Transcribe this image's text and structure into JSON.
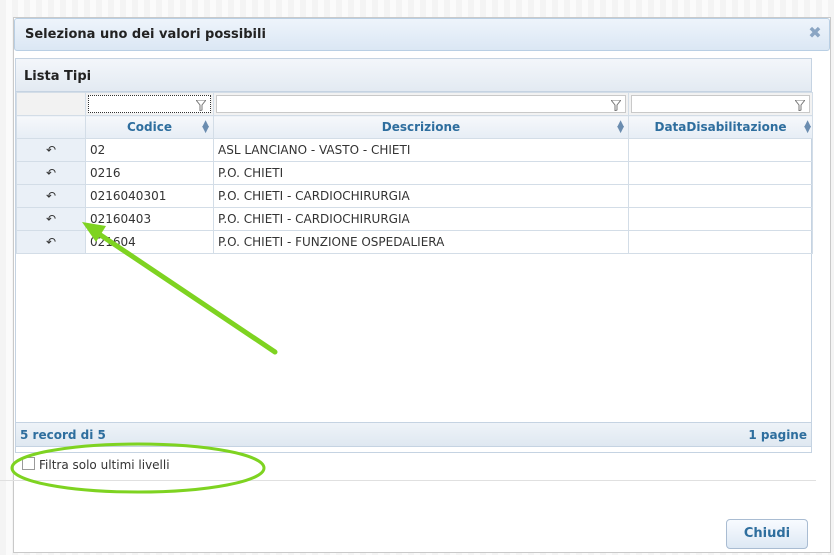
{
  "dialog": {
    "title": "Seleziona uno dei valori possibili",
    "close_icon": "close-icon"
  },
  "grid": {
    "caption": "Lista Tipi",
    "columns": [
      "Codice",
      "Descrizione",
      "DataDisabilitazione"
    ],
    "rows": [
      {
        "codice": "02",
        "descrizione": "ASL LANCIANO - VASTO - CHIETI",
        "data": ""
      },
      {
        "codice": "0216",
        "descrizione": "P.O. CHIETI",
        "data": ""
      },
      {
        "codice": "0216040301",
        "descrizione": "P.O. CHIETI - CARDIOCHIRURGIA",
        "data": ""
      },
      {
        "codice": "02160403",
        "descrizione": "P.O. CHIETI - CARDIOCHIRURGIA",
        "data": ""
      },
      {
        "codice": "021604",
        "descrizione": "P.O. CHIETI - FUNZIONE OSPEDALIERA",
        "data": ""
      }
    ],
    "row_icon": "select-arrow-icon"
  },
  "footer": {
    "records": "5 record di 5",
    "pages": "1 pagine"
  },
  "filter_checkbox": {
    "label": "Filtra solo ultimi livelli",
    "checked": false
  },
  "buttons": {
    "close": "Chiudi"
  },
  "colors": {
    "annotation": "#7ed321",
    "accent": "#2e6e9e"
  }
}
